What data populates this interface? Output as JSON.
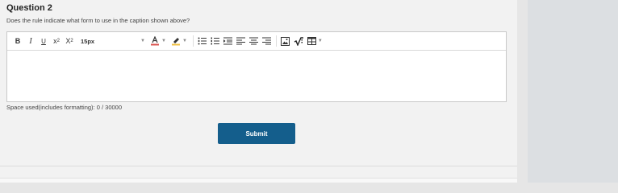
{
  "question": {
    "title": "Question 2",
    "prompt": "Does the rule indicate what form to use in the caption shown above?"
  },
  "toolbar": {
    "bold": "B",
    "italic": "I",
    "underline": "U",
    "superscript_base": "x",
    "superscript_mark": "2",
    "subscript_base": "X",
    "subscript_mark": "2",
    "font_size": "15px",
    "icons": [
      "font-color-icon",
      "highlight-color-icon",
      "bullet-list-icon",
      "numbered-list-icon",
      "indent-icon",
      "align-left-icon",
      "align-center-icon",
      "align-right-icon",
      "insert-image-icon",
      "math-equation-icon",
      "insert-table-icon"
    ]
  },
  "editor": {
    "value": ""
  },
  "space_used": "Space used(includes formatting): 0 / 30000",
  "submit_label": "Submit",
  "colors": {
    "submit_bg": "#145e8c",
    "font_color_underline": "#d9534f",
    "highlight_underline": "#f0c040"
  }
}
